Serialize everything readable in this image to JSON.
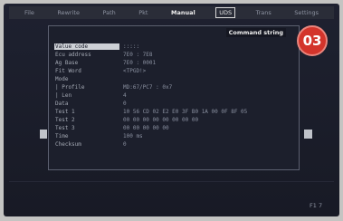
{
  "menu": {
    "items": [
      {
        "label": "File"
      },
      {
        "label": "Rewrite"
      },
      {
        "label": "Path"
      },
      {
        "label": "Pkt"
      },
      {
        "label": "Manual",
        "active": true
      },
      {
        "label": "UDS",
        "boxed": true
      },
      {
        "label": "Trans"
      },
      {
        "label": "Settings"
      }
    ]
  },
  "panel": {
    "title": "Command string",
    "rows": [
      {
        "label": "Value code",
        "value": ":::::",
        "selected": true
      },
      {
        "label": "Ecu address",
        "value": "7E0 : 7E8"
      },
      {
        "label": "Ag Base",
        "value": "7E0 : 0001"
      },
      {
        "label": "Fit Word",
        "value": "<TPGD!>"
      },
      {
        "label": "Mode",
        "value": ""
      },
      {
        "label": "| Profile",
        "value": "MD:67/PC7 : 0x7"
      },
      {
        "label": "| Len",
        "value": "4"
      },
      {
        "label": "Data",
        "value": "0"
      },
      {
        "label": "Test 1",
        "value": "10 56 CD 02 E2 E0 3F B0 1A 00 0F 8F 05"
      },
      {
        "label": "Test 2",
        "value": "00 00 00 00 00 00 00 00"
      },
      {
        "label": "Test 3",
        "value": "00 00 00 00 00"
      },
      {
        "label": "Time",
        "value": "100 ms"
      },
      {
        "label": "Checksum",
        "value": "0"
      }
    ]
  },
  "badge": {
    "text": "03"
  },
  "footer": {
    "text": "F1 7"
  },
  "icons": {
    "scroll_left": "scroll-left-icon",
    "scroll_right": "scroll-right-icon"
  },
  "colors": {
    "accent": "#d3342b",
    "background": "#1b1e2b",
    "highlight": "#cdd0d6"
  }
}
